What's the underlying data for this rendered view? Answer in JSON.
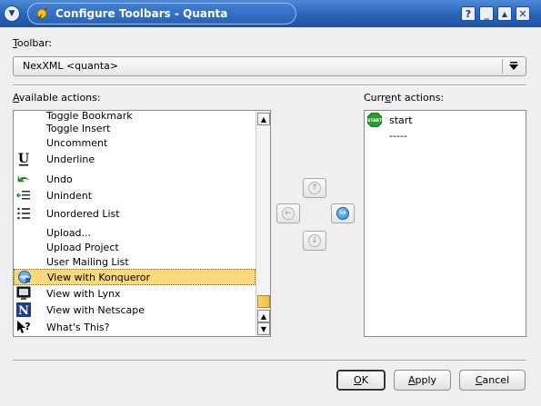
{
  "window": {
    "title": "Configure Toolbars - Quanta",
    "buttons": {
      "help": "?",
      "minimize": "_",
      "maximize": "▲",
      "close": "✕"
    }
  },
  "toolbar": {
    "label_prefix": "T",
    "label_rest": "oolbar:",
    "selected": "NexXML <quanta>"
  },
  "available": {
    "label_prefix": "A",
    "label_rest": "vailable actions:",
    "items": [
      {
        "label": "Toggle Bookmark",
        "icon": "none"
      },
      {
        "label": "Toggle Insert",
        "icon": "none"
      },
      {
        "label": "Uncomment",
        "icon": "none"
      },
      {
        "label": "Underline",
        "icon": "underline-icon"
      },
      {
        "label": "Undo",
        "icon": "undo-icon"
      },
      {
        "label": "Unindent",
        "icon": "unindent-icon"
      },
      {
        "label": "Unordered List",
        "icon": "unordered-list-icon"
      },
      {
        "label": "Upload...",
        "icon": "none"
      },
      {
        "label": "Upload Project",
        "icon": "none"
      },
      {
        "label": "User Mailing List",
        "icon": "none"
      },
      {
        "label": "View with Konqueror",
        "icon": "konqueror-icon",
        "selected": true
      },
      {
        "label": "View with Lynx",
        "icon": "lynx-icon"
      },
      {
        "label": "View with Netscape",
        "icon": "netscape-icon"
      },
      {
        "label": "What's This?",
        "icon": "whats-this-icon"
      }
    ]
  },
  "current": {
    "label_prefix": "Curr",
    "label_u": "e",
    "label_rest": "nt actions:",
    "items": [
      {
        "label": "start",
        "icon": "start-icon"
      },
      {
        "label": "-----",
        "icon": "none"
      }
    ]
  },
  "buttons": {
    "ok_u": "O",
    "ok_rest": "K",
    "apply_u": "A",
    "apply_rest": "pply",
    "cancel_u": "C",
    "cancel_rest": "ancel"
  },
  "colors": {
    "titlebar": "#2a63b8",
    "selection": "#fbd97a",
    "active_arrow": "#2b7ed6"
  }
}
